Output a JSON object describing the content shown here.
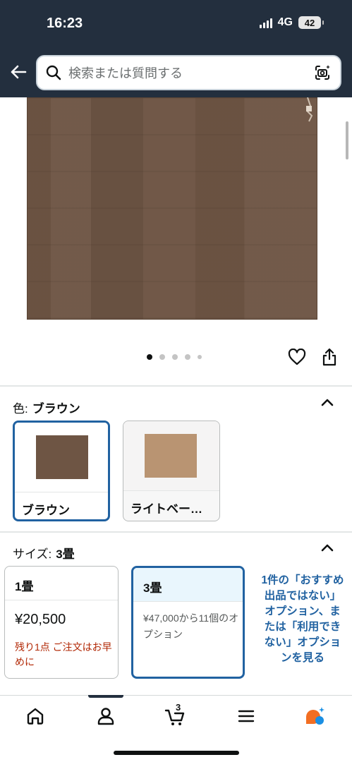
{
  "status_bar": {
    "time": "16:23",
    "network": "4G",
    "battery": "42"
  },
  "search": {
    "placeholder": "検索または質問する"
  },
  "colors": {
    "header_bg": "#232f3e",
    "selected_border": "#2162a1",
    "alert_text": "#b12704",
    "brown_swatch": "#6e5544",
    "beige_swatch": "#b99472"
  },
  "gallery": {
    "image_count": 5,
    "active_index": 0
  },
  "color_selector": {
    "label": "色:",
    "selected_value": "ブラウン",
    "options": [
      {
        "name": "ブラウン",
        "selected": true
      },
      {
        "name": "ライトベー…",
        "selected": false
      }
    ]
  },
  "size_selector": {
    "label": "サイズ:",
    "selected_value": "3畳",
    "options": [
      {
        "name": "1畳",
        "price": "¥20,500",
        "note": "残り1点 ご注文はお早めに",
        "selected": false
      },
      {
        "name": "3畳",
        "subtext": "¥47,000から11個のオプション",
        "selected": true
      }
    ],
    "unavailable_text": "1件の「おすすめ出品ではない」オプション、または「利用できない」オプションを見る"
  },
  "tabbar": {
    "items": [
      {
        "icon": "home-icon"
      },
      {
        "icon": "account-icon"
      },
      {
        "icon": "cart-icon",
        "count": "3"
      },
      {
        "icon": "menu-icon"
      },
      {
        "icon": "rufus-ai-icon"
      }
    ]
  }
}
